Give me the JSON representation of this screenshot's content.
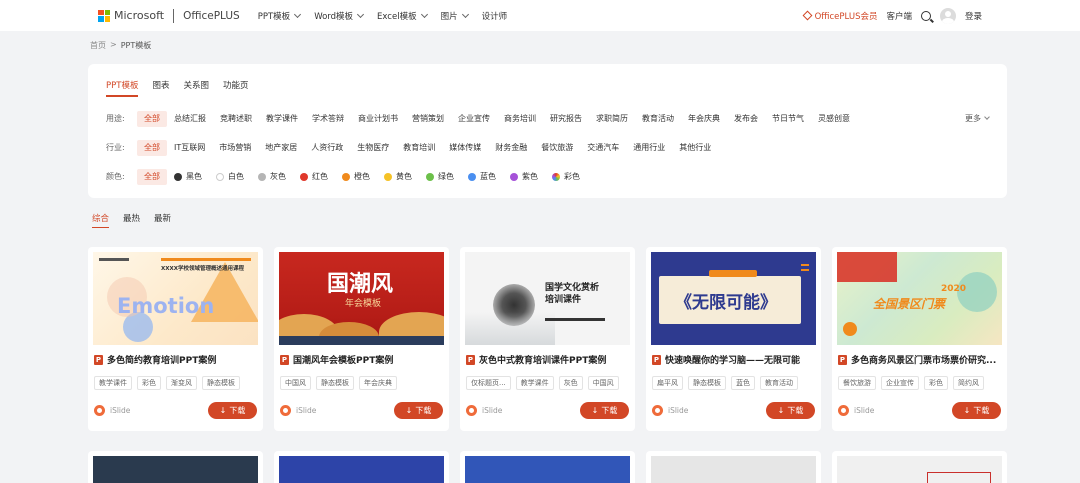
{
  "header": {
    "logo_ms": "Microsoft",
    "logo_op": "OfficePLUS",
    "nav": [
      {
        "label": "PPT模板",
        "has_menu": true
      },
      {
        "label": "Word模板",
        "has_menu": true
      },
      {
        "label": "Excel模板",
        "has_menu": true
      },
      {
        "label": "图片",
        "has_menu": true
      },
      {
        "label": "设计师",
        "has_menu": false
      }
    ],
    "member": "OfficePLUS会员",
    "client": "客户端",
    "login": "登录"
  },
  "breadcrumb": {
    "home": "首页",
    "sep": ">",
    "current": "PPT模板"
  },
  "panel": {
    "tabs": [
      "PPT模板",
      "图表",
      "关系图",
      "功能页"
    ],
    "usage": {
      "label": "用途:",
      "options": [
        "全部",
        "总结汇报",
        "竞聘述职",
        "教学课件",
        "学术答辩",
        "商业计划书",
        "营销策划",
        "企业宣传",
        "商务培训",
        "研究报告",
        "求职简历",
        "教育活动",
        "年会庆典",
        "发布会",
        "节日节气",
        "灵感创意"
      ],
      "more": "更多"
    },
    "industry": {
      "label": "行业:",
      "options": [
        "全部",
        "IT互联网",
        "市场营销",
        "地产家居",
        "人资行政",
        "生物医疗",
        "教育培训",
        "媒体传媒",
        "财务金融",
        "餐饮旅游",
        "交通汽车",
        "通用行业",
        "其他行业"
      ]
    },
    "color": {
      "label": "颜色:",
      "options": [
        {
          "name": "全部",
          "dot": ""
        },
        {
          "name": "黑色",
          "dot": "#333333"
        },
        {
          "name": "白色",
          "dot": "#ffffff"
        },
        {
          "name": "灰色",
          "dot": "#b5b5b5"
        },
        {
          "name": "红色",
          "dot": "#e0382b"
        },
        {
          "name": "橙色",
          "dot": "#f08a1c"
        },
        {
          "name": "黄色",
          "dot": "#f5c226"
        },
        {
          "name": "绿色",
          "dot": "#6cc04a"
        },
        {
          "name": "蓝色",
          "dot": "#4a8ff0"
        },
        {
          "name": "紫色",
          "dot": "#a552d8"
        },
        {
          "name": "彩色",
          "dot": "rainbow"
        }
      ]
    }
  },
  "sort": [
    "综合",
    "最热",
    "最新"
  ],
  "cards": [
    {
      "title": "多色简约教育培训PPT案例",
      "tags": [
        "教学课件",
        "彩色",
        "渐变风",
        "静态模板"
      ],
      "author": "iSlide",
      "download": "下载",
      "thumb_text": "Emotion",
      "thumb_sub": "XXXX学校领域管理概述通用课程"
    },
    {
      "title": "国潮风年会模板PPT案例",
      "tags": [
        "中国风",
        "静态模板",
        "年会庆典"
      ],
      "author": "iSlide",
      "download": "下载",
      "thumb_text": "国潮风",
      "thumb_sub": "年会模板"
    },
    {
      "title": "灰色中式教育培训课件PPT案例",
      "tags": [
        "仅标题页...",
        "教学课件",
        "灰色",
        "中国风"
      ],
      "author": "iSlide",
      "download": "下载",
      "thumb_text": "国学文化赏析",
      "thumb_sub": "培训课件"
    },
    {
      "title": "快速唤醒你的学习脑——无限可能",
      "tags": [
        "扁平风",
        "静态模板",
        "蓝色",
        "教育活动"
      ],
      "author": "iSlide",
      "download": "下载",
      "thumb_text": "《无限可能》",
      "thumb_sub": ""
    },
    {
      "title": "多色商务风景区门票市场票价研究...",
      "tags": [
        "餐饮旅游",
        "企业宣传",
        "彩色",
        "简约风"
      ],
      "author": "iSlide",
      "download": "下载",
      "thumb_text": "全国景区门票",
      "thumb_sub": "2020"
    }
  ]
}
